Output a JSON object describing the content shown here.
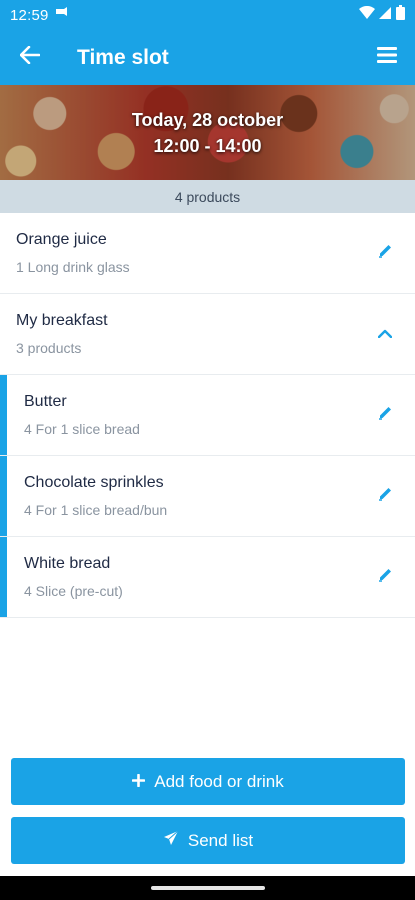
{
  "status_bar": {
    "time": "12:59"
  },
  "app_bar": {
    "title": "Time slot"
  },
  "banner": {
    "date": "Today, 28 october",
    "time_range": "12:00 - 14:00"
  },
  "product_count": "4 products",
  "items": [
    {
      "title": "Orange juice",
      "subtitle": "1 Long drink glass"
    },
    {
      "title": "My breakfast",
      "subtitle": "3 products"
    }
  ],
  "sub_items": [
    {
      "title": "Butter",
      "subtitle": "4 For 1 slice bread"
    },
    {
      "title": "Chocolate sprinkles",
      "subtitle": "4 For 1 slice bread/bun"
    },
    {
      "title": "White bread",
      "subtitle": "4 Slice (pre-cut)"
    }
  ],
  "buttons": {
    "add_label": "Add food or drink",
    "send_label": "Send list"
  },
  "colors": {
    "primary": "#1aa3e6",
    "count_bar": "#cfdbe3"
  }
}
